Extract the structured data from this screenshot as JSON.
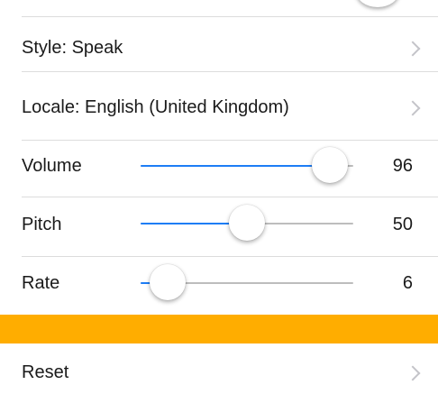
{
  "colors": {
    "accent": "#1e7df5",
    "banner": "#ffad00",
    "chevron": "#c4c4c9"
  },
  "settings": {
    "style_label": "Style: Speak",
    "locale_label": "Locale: English (United Kingdom)",
    "reset_label": "Reset",
    "chevron_icon": "chevron-right-icon"
  },
  "sliders": {
    "volume": {
      "label": "Volume",
      "value": "96",
      "fraction": 0.89
    },
    "pitch": {
      "label": "Pitch",
      "value": "50",
      "fraction": 0.5
    },
    "rate": {
      "label": "Rate",
      "value": "6",
      "fraction": 0.125
    }
  }
}
